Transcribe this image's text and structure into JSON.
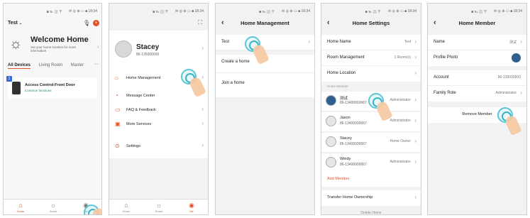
{
  "screen1": {
    "status_time": "■ ℡ ◫ 〒",
    "status_right": "✉ ◎ ⊕ ▭ ■ 18:34",
    "home_selector": "Test",
    "welcome_title": "Welcome Home",
    "welcome_sub": "Set your home location for more information",
    "tabs": [
      "All Devices",
      "Living Room",
      "Master"
    ],
    "more": "···",
    "device_name": "Access Control-Front Door",
    "device_status": "Common functions",
    "device_badge": "1",
    "bottom_tabs": [
      "Home",
      "Smart",
      "Me"
    ]
  },
  "screen2": {
    "user_name": "Stacey",
    "user_phone": "86-135000000",
    "menu": [
      "Home Management",
      "Message Center",
      "FAQ & Feedback",
      "More Services",
      "Settings"
    ],
    "bottom_tabs": [
      "Home",
      "Smart",
      "Me"
    ]
  },
  "screen3": {
    "title": "Home Management",
    "home_item": "Test",
    "create": "Create a home",
    "join": "Join a home"
  },
  "screen4": {
    "title": "Home Settings",
    "home_name_label": "Home Name",
    "home_name_value": "Test",
    "room_label": "Room Management",
    "room_value": "1 Room(s)",
    "location_label": "Home Location",
    "section_label": "Home Member",
    "members": [
      {
        "name": "测试",
        "phone": "86-13400000067",
        "role": "Administrator"
      },
      {
        "name": "Jason",
        "phone": "86-13400000067",
        "role": "Administrator"
      },
      {
        "name": "Stacey",
        "phone": "86-13400000067",
        "role": "Home Owner"
      },
      {
        "name": "Windy",
        "phone": "86-13400000067",
        "role": "Administrator"
      }
    ],
    "add_member": "Add Member",
    "transfer": "Transfer Home Ownership",
    "delete": "Delete Home"
  },
  "screen5": {
    "title": "Home Member",
    "name_label": "Name",
    "name_value": "测试",
    "photo_label": "Profile Photo",
    "account_label": "Account",
    "account_value": "86-135000000",
    "role_label": "Family Role",
    "role_value": "Administrator",
    "remove": "Remove Member"
  },
  "colors": {
    "accent": "#e0522a",
    "tap": "#5bc6d4"
  }
}
